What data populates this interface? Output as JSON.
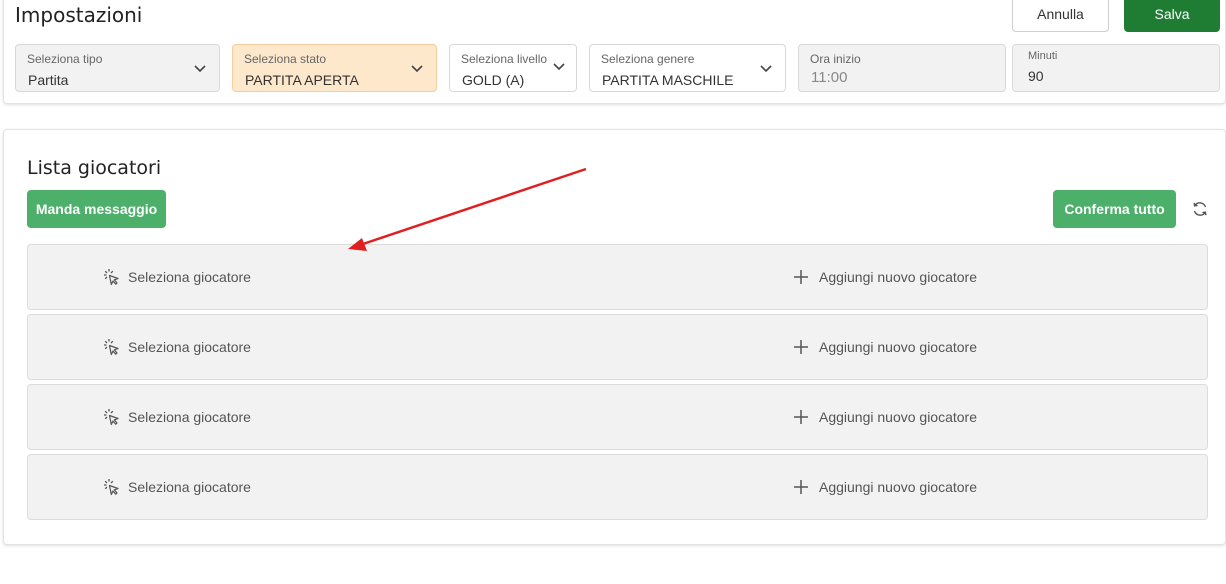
{
  "header": {
    "title": "Impostazioni",
    "cancel_label": "Annulla",
    "save_label": "Salva",
    "save_color": "#1e7d32"
  },
  "filters": [
    {
      "label": "Seleziona tipo",
      "value": "Partita"
    },
    {
      "label": "Seleziona stato",
      "value": "PARTITA APERTA"
    },
    {
      "label": "Seleziona livello",
      "value": "GOLD (A)"
    },
    {
      "label": "Seleziona genere",
      "value": "PARTITA MASCHILE"
    },
    {
      "label": "Ora inizio",
      "value": "11:00"
    },
    {
      "label": "Minuti",
      "value": "90"
    }
  ],
  "players": {
    "title": "Lista giocatori",
    "send_message_label": "Manda messaggio",
    "confirm_all_label": "Conferma tutto",
    "accent_color": "#4caf6a",
    "rows": [
      {
        "select_label": "Seleziona giocatore",
        "add_label": "Aggiungi nuovo giocatore"
      },
      {
        "select_label": "Seleziona giocatore",
        "add_label": "Aggiungi nuovo giocatore"
      },
      {
        "select_label": "Seleziona giocatore",
        "add_label": "Aggiungi nuovo giocatore"
      },
      {
        "select_label": "Seleziona giocatore",
        "add_label": "Aggiungi nuovo giocatore"
      }
    ]
  },
  "annotation": {
    "arrow_color": "#e02020"
  }
}
